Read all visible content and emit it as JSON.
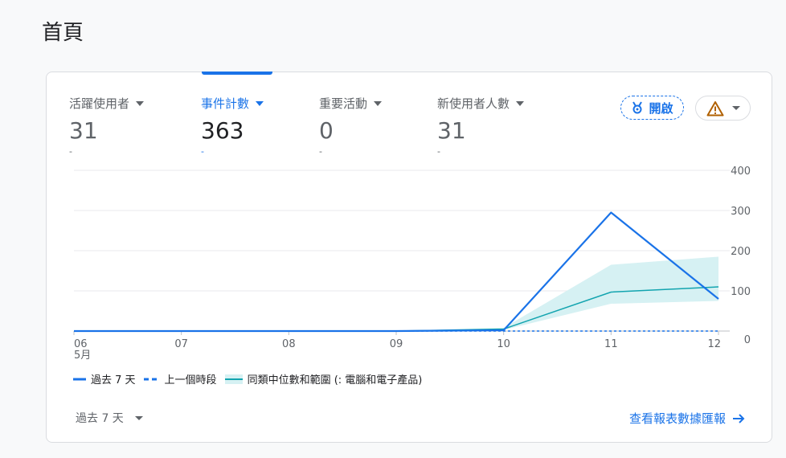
{
  "page": {
    "title": "首頁"
  },
  "metrics": [
    {
      "label": "活躍使用者",
      "value": "31",
      "delta": "-"
    },
    {
      "label": "事件計數",
      "value": "363",
      "delta": "-"
    },
    {
      "label": "重要活動",
      "value": "0",
      "delta": "-"
    },
    {
      "label": "新使用者人數",
      "value": "31",
      "delta": "-"
    }
  ],
  "actions": {
    "open_label": "開啟",
    "open_icon": "insights-icon",
    "warning_icon": "warning-icon"
  },
  "colors": {
    "primary": "#1a73e8",
    "benchmark": "#12a4af",
    "band": "#d6f1f3",
    "warning": "#b06000"
  },
  "chart_data": {
    "type": "line",
    "x": [
      "06",
      "07",
      "08",
      "09",
      "10",
      "11",
      "12"
    ],
    "x_sublabel": "5月",
    "ylim": [
      0,
      400
    ],
    "yticks": [
      "400",
      "300",
      "200",
      "100",
      "0"
    ],
    "series": [
      {
        "name": "過去 7 天",
        "values": [
          0,
          0,
          0,
          0,
          2,
          295,
          80
        ]
      },
      {
        "name": "上一個時段",
        "values": [
          0,
          0,
          0,
          0,
          0,
          0,
          0
        ]
      },
      {
        "name": "同類中位數和範圍 (: 電腦和電子產品)",
        "values": [
          0,
          0,
          0,
          0,
          5,
          97,
          110
        ],
        "range_low": [
          0,
          0,
          0,
          0,
          3,
          68,
          75
        ],
        "range_high": [
          0,
          0,
          0,
          0,
          8,
          165,
          185
        ]
      }
    ],
    "legend": [
      "過去 7 天",
      "上一個時段",
      "同類中位數和範圍 (: 電腦和電子產品)"
    ],
    "grid": true,
    "y_axis_side": "right"
  },
  "footer": {
    "range_label": "過去 7 天",
    "report_link": "查看報表數據匯報"
  }
}
